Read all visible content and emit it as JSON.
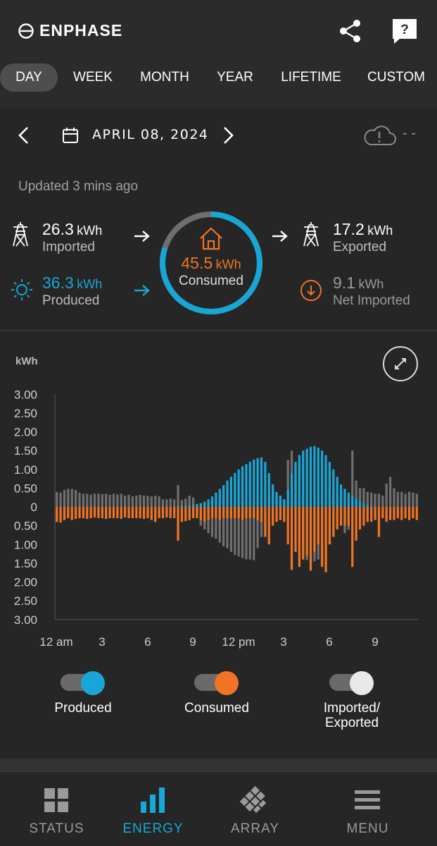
{
  "app": {
    "brand": "ENPHASE"
  },
  "colors": {
    "produced": "#18a6d6",
    "consumed": "#f07423",
    "grid": "#6f6f6f",
    "accent": "#18a6d6"
  },
  "tabs": [
    "DAY",
    "WEEK",
    "MONTH",
    "YEAR",
    "LIFETIME",
    "CUSTOM"
  ],
  "active_tab": "DAY",
  "date": {
    "text": "APRIL 08, 2024",
    "weather": "- -"
  },
  "updated": "Updated 3 mins ago",
  "summary": {
    "imported": {
      "value": "26.3",
      "unit": "kWh",
      "label": "Imported"
    },
    "produced": {
      "value": "36.3",
      "unit": "kWh",
      "label": "Produced"
    },
    "consumed": {
      "value": "45.5",
      "unit": "kWh",
      "label": "Consumed"
    },
    "exported": {
      "value": "17.2",
      "unit": "kWh",
      "label": "Exported"
    },
    "net": {
      "value": "9.1",
      "unit": "kWh",
      "label": "Net Imported"
    },
    "ring_fraction_produced": 0.8
  },
  "chart_data": {
    "type": "bar",
    "ylabel": "kWh",
    "y_ticks": [
      "3.00",
      "2.50",
      "2.00",
      "1.50",
      "1.00",
      "0.50",
      "0",
      "0.50",
      "1.00",
      "1.50",
      "2.00",
      "2.50",
      "3.00"
    ],
    "ylim": [
      -3,
      3
    ],
    "x_ticks": [
      "12 am",
      "3",
      "6",
      "9",
      "12 pm",
      "3",
      "6",
      "9"
    ],
    "interval_minutes": 15,
    "series": [
      {
        "name": "Produced",
        "values": [
          0,
          0,
          0,
          0,
          0,
          0,
          0,
          0,
          0,
          0,
          0,
          0,
          0,
          0,
          0,
          0,
          0,
          0,
          0,
          0,
          0,
          0,
          0,
          0,
          0,
          0,
          0,
          0,
          0,
          0,
          0,
          0,
          0.02,
          0.03,
          0.04,
          0.05,
          0.06,
          0.08,
          0.1,
          0.14,
          0.2,
          0.28,
          0.38,
          0.48,
          0.58,
          0.7,
          0.8,
          0.9,
          1.0,
          1.08,
          1.14,
          1.2,
          1.26,
          1.3,
          1.32,
          1.2,
          0.9,
          0.6,
          0.4,
          0.3,
          0.2,
          0.45,
          0.9,
          1.2,
          1.38,
          1.5,
          1.55,
          1.6,
          1.62,
          1.58,
          1.5,
          1.38,
          1.2,
          1.0,
          0.8,
          0.6,
          0.48,
          0.38,
          0.3,
          0.22,
          0.15,
          0.09,
          0.05,
          0.02,
          0,
          0,
          0,
          0,
          0,
          0,
          0,
          0,
          0,
          0,
          0,
          0
        ]
      },
      {
        "name": "Consumed",
        "values": [
          -0.4,
          -0.42,
          -0.35,
          -0.3,
          -0.35,
          -0.32,
          -0.3,
          -0.3,
          -0.32,
          -0.3,
          -0.28,
          -0.3,
          -0.3,
          -0.32,
          -0.3,
          -0.3,
          -0.3,
          -0.32,
          -0.28,
          -0.3,
          -0.3,
          -0.3,
          -0.3,
          -0.32,
          -0.3,
          -0.35,
          -0.4,
          -0.3,
          -0.3,
          -0.28,
          -0.3,
          -0.3,
          -0.9,
          -0.4,
          -0.38,
          -0.35,
          -0.3,
          -0.3,
          -0.35,
          -0.4,
          -0.35,
          -0.3,
          -0.3,
          -0.35,
          -0.3,
          -0.3,
          -0.3,
          -0.3,
          -0.3,
          -0.35,
          -0.3,
          -0.3,
          -0.3,
          -0.35,
          -0.4,
          -0.8,
          -1.0,
          -0.5,
          -0.4,
          -0.35,
          -0.4,
          -1.0,
          -1.68,
          -1.2,
          -1.6,
          -1.4,
          -1.3,
          -1.7,
          -1.2,
          -1.0,
          -1.6,
          -1.74,
          -1.0,
          -0.8,
          -0.6,
          -0.5,
          -0.5,
          -0.5,
          -1.6,
          -0.9,
          -0.6,
          -0.5,
          -0.4,
          -0.4,
          -0.35,
          -0.8,
          -0.3,
          -0.4,
          -0.35,
          -0.35,
          -0.3,
          -0.35,
          -0.3,
          -0.35,
          -0.3,
          -0.35
        ]
      },
      {
        "name": "Imported/Exported",
        "values": [
          0.4,
          0.38,
          0.45,
          0.48,
          0.48,
          0.45,
          0.38,
          0.35,
          0.35,
          0.33,
          0.35,
          0.35,
          0.34,
          0.35,
          0.32,
          0.35,
          0.33,
          0.35,
          0.3,
          0.32,
          0.28,
          0.3,
          0.32,
          0.3,
          0.3,
          0.28,
          0.3,
          0.28,
          0.2,
          0.2,
          0.22,
          0.2,
          0.58,
          0.18,
          0.22,
          0.3,
          0.25,
          -0.3,
          -0.5,
          -0.6,
          -0.7,
          -0.8,
          -0.85,
          -0.95,
          -1.05,
          -1.1,
          -1.2,
          -1.28,
          -1.32,
          -1.36,
          -1.4,
          -1.4,
          -1.42,
          -1.1,
          -0.8,
          0.42,
          0.3,
          0.6,
          0.35,
          0.3,
          0.2,
          1.25,
          1.5,
          0.6,
          -1.0,
          -1.3,
          -1.42,
          -1.5,
          -1.45,
          -1.4,
          -1.52,
          -1.5,
          1.1,
          0.5,
          0.3,
          0.5,
          -0.7,
          -0.6,
          1.5,
          0.7,
          0.5,
          0.5,
          0.4,
          0.38,
          0.35,
          0.35,
          0.3,
          0.62,
          0.8,
          0.5,
          0.4,
          0.4,
          0.35,
          0.4,
          0.38,
          0.35
        ]
      }
    ]
  },
  "toggles": [
    {
      "label": "Produced",
      "color": "#18a6d6"
    },
    {
      "label": "Consumed",
      "color": "#f07423"
    },
    {
      "label": "Imported/\nExported",
      "color": "#e8e8e8"
    }
  ],
  "nav": [
    {
      "label": "STATUS",
      "icon": "grid-icon"
    },
    {
      "label": "ENERGY",
      "icon": "bar-chart-icon"
    },
    {
      "label": "ARRAY",
      "icon": "solar-panel-icon"
    },
    {
      "label": "MENU",
      "icon": "hamburger-icon"
    }
  ],
  "active_nav": "ENERGY"
}
